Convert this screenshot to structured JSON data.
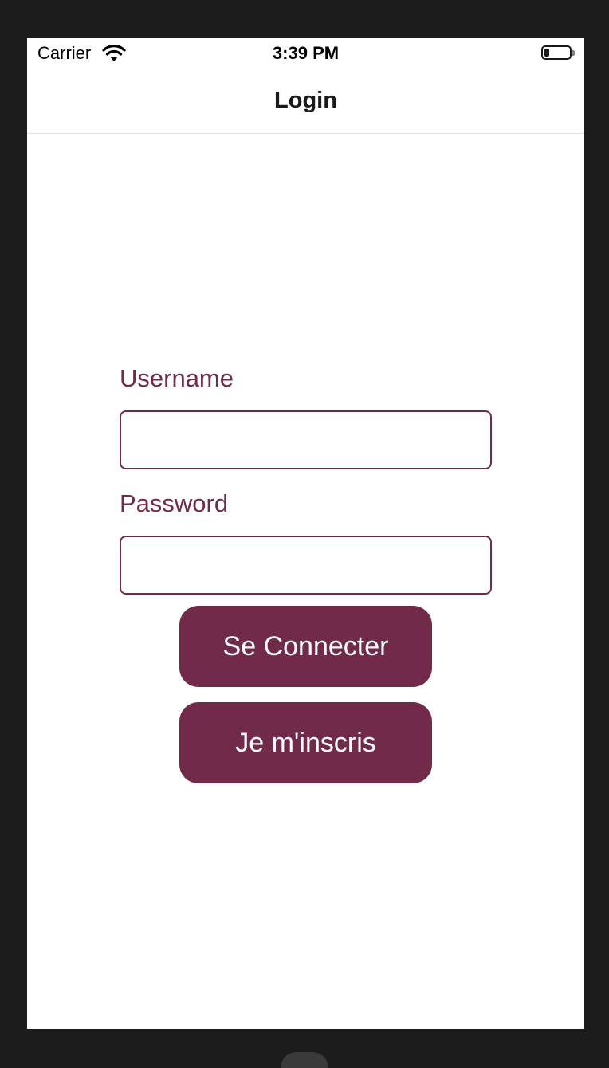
{
  "status_bar": {
    "carrier": "Carrier",
    "time": "3:39 PM",
    "wifi_icon": "wifi-icon",
    "battery_icon": "battery-icon",
    "battery_level": 0.2
  },
  "nav": {
    "title": "Login"
  },
  "form": {
    "username_label": "Username",
    "username_value": "",
    "password_label": "Password",
    "password_value": ""
  },
  "buttons": {
    "login_label": "Se Connecter",
    "signup_label": "Je m'inscris"
  },
  "colors": {
    "accent": "#722a4b",
    "background": "#ffffff",
    "frame": "#1c1c1c"
  }
}
